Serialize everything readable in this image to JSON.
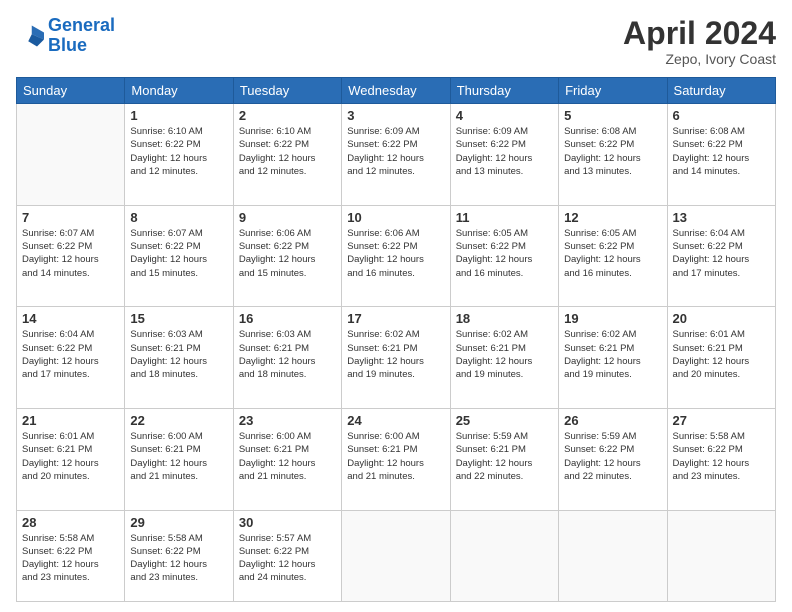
{
  "header": {
    "logo_line1": "General",
    "logo_line2": "Blue",
    "month": "April 2024",
    "location": "Zepo, Ivory Coast"
  },
  "weekdays": [
    "Sunday",
    "Monday",
    "Tuesday",
    "Wednesday",
    "Thursday",
    "Friday",
    "Saturday"
  ],
  "weeks": [
    [
      {
        "day": "",
        "info": ""
      },
      {
        "day": "1",
        "info": "Sunrise: 6:10 AM\nSunset: 6:22 PM\nDaylight: 12 hours\nand 12 minutes."
      },
      {
        "day": "2",
        "info": "Sunrise: 6:10 AM\nSunset: 6:22 PM\nDaylight: 12 hours\nand 12 minutes."
      },
      {
        "day": "3",
        "info": "Sunrise: 6:09 AM\nSunset: 6:22 PM\nDaylight: 12 hours\nand 12 minutes."
      },
      {
        "day": "4",
        "info": "Sunrise: 6:09 AM\nSunset: 6:22 PM\nDaylight: 12 hours\nand 13 minutes."
      },
      {
        "day": "5",
        "info": "Sunrise: 6:08 AM\nSunset: 6:22 PM\nDaylight: 12 hours\nand 13 minutes."
      },
      {
        "day": "6",
        "info": "Sunrise: 6:08 AM\nSunset: 6:22 PM\nDaylight: 12 hours\nand 14 minutes."
      }
    ],
    [
      {
        "day": "7",
        "info": "Sunrise: 6:07 AM\nSunset: 6:22 PM\nDaylight: 12 hours\nand 14 minutes."
      },
      {
        "day": "8",
        "info": "Sunrise: 6:07 AM\nSunset: 6:22 PM\nDaylight: 12 hours\nand 15 minutes."
      },
      {
        "day": "9",
        "info": "Sunrise: 6:06 AM\nSunset: 6:22 PM\nDaylight: 12 hours\nand 15 minutes."
      },
      {
        "day": "10",
        "info": "Sunrise: 6:06 AM\nSunset: 6:22 PM\nDaylight: 12 hours\nand 16 minutes."
      },
      {
        "day": "11",
        "info": "Sunrise: 6:05 AM\nSunset: 6:22 PM\nDaylight: 12 hours\nand 16 minutes."
      },
      {
        "day": "12",
        "info": "Sunrise: 6:05 AM\nSunset: 6:22 PM\nDaylight: 12 hours\nand 16 minutes."
      },
      {
        "day": "13",
        "info": "Sunrise: 6:04 AM\nSunset: 6:22 PM\nDaylight: 12 hours\nand 17 minutes."
      }
    ],
    [
      {
        "day": "14",
        "info": "Sunrise: 6:04 AM\nSunset: 6:22 PM\nDaylight: 12 hours\nand 17 minutes."
      },
      {
        "day": "15",
        "info": "Sunrise: 6:03 AM\nSunset: 6:21 PM\nDaylight: 12 hours\nand 18 minutes."
      },
      {
        "day": "16",
        "info": "Sunrise: 6:03 AM\nSunset: 6:21 PM\nDaylight: 12 hours\nand 18 minutes."
      },
      {
        "day": "17",
        "info": "Sunrise: 6:02 AM\nSunset: 6:21 PM\nDaylight: 12 hours\nand 19 minutes."
      },
      {
        "day": "18",
        "info": "Sunrise: 6:02 AM\nSunset: 6:21 PM\nDaylight: 12 hours\nand 19 minutes."
      },
      {
        "day": "19",
        "info": "Sunrise: 6:02 AM\nSunset: 6:21 PM\nDaylight: 12 hours\nand 19 minutes."
      },
      {
        "day": "20",
        "info": "Sunrise: 6:01 AM\nSunset: 6:21 PM\nDaylight: 12 hours\nand 20 minutes."
      }
    ],
    [
      {
        "day": "21",
        "info": "Sunrise: 6:01 AM\nSunset: 6:21 PM\nDaylight: 12 hours\nand 20 minutes."
      },
      {
        "day": "22",
        "info": "Sunrise: 6:00 AM\nSunset: 6:21 PM\nDaylight: 12 hours\nand 21 minutes."
      },
      {
        "day": "23",
        "info": "Sunrise: 6:00 AM\nSunset: 6:21 PM\nDaylight: 12 hours\nand 21 minutes."
      },
      {
        "day": "24",
        "info": "Sunrise: 6:00 AM\nSunset: 6:21 PM\nDaylight: 12 hours\nand 21 minutes."
      },
      {
        "day": "25",
        "info": "Sunrise: 5:59 AM\nSunset: 6:21 PM\nDaylight: 12 hours\nand 22 minutes."
      },
      {
        "day": "26",
        "info": "Sunrise: 5:59 AM\nSunset: 6:22 PM\nDaylight: 12 hours\nand 22 minutes."
      },
      {
        "day": "27",
        "info": "Sunrise: 5:58 AM\nSunset: 6:22 PM\nDaylight: 12 hours\nand 23 minutes."
      }
    ],
    [
      {
        "day": "28",
        "info": "Sunrise: 5:58 AM\nSunset: 6:22 PM\nDaylight: 12 hours\nand 23 minutes."
      },
      {
        "day": "29",
        "info": "Sunrise: 5:58 AM\nSunset: 6:22 PM\nDaylight: 12 hours\nand 23 minutes."
      },
      {
        "day": "30",
        "info": "Sunrise: 5:57 AM\nSunset: 6:22 PM\nDaylight: 12 hours\nand 24 minutes."
      },
      {
        "day": "",
        "info": ""
      },
      {
        "day": "",
        "info": ""
      },
      {
        "day": "",
        "info": ""
      },
      {
        "day": "",
        "info": ""
      }
    ]
  ]
}
